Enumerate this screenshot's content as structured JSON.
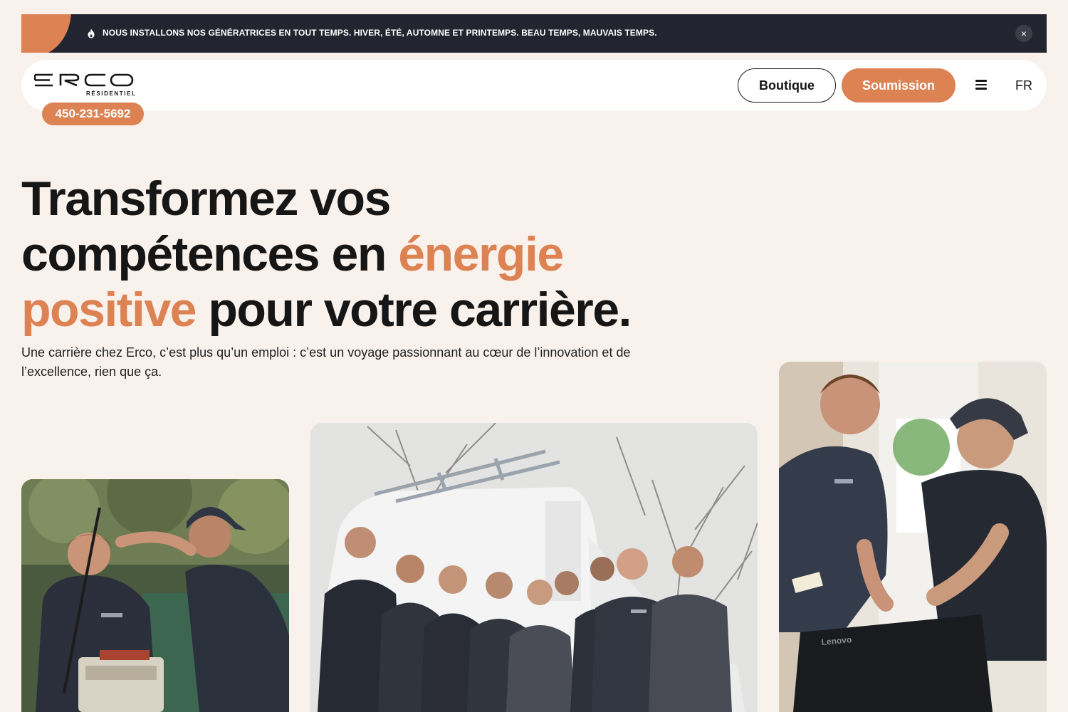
{
  "announcement": {
    "text": "NOUS INSTALLONS NOS GÉNÉRATRICES EN TOUT TEMPS. HIVER, ÉTÉ, AUTOMNE ET PRINTEMPS. BEAU TEMPS, MAUVAIS TEMPS.",
    "close_label": "×",
    "icon": "flame-icon"
  },
  "header": {
    "logo_text": "ERCO",
    "logo_sub": "RÉSIDENTIEL",
    "boutique_label": "Boutique",
    "soumission_label": "Soumission",
    "menu_icon": "hamburger-menu-icon",
    "lang_label": "FR",
    "phone": "450-231-5692"
  },
  "hero": {
    "line1": "Transformez vos",
    "line2_start": "compétences en ",
    "line2_accent": "énergie",
    "line3_accent": "positive",
    "line3_end": " pour votre carrière.",
    "lede": "Une carrière chez Erco, c’est plus qu’un emploi : c’est un voyage passionnant au cœur de l’innovation et de l’excellence, rien que ça."
  },
  "photos": {
    "left_label": "ERCO",
    "center_label": "ERCO",
    "right_label": "ERCO",
    "laptop_brand": "Lenovo"
  },
  "colors": {
    "accent": "#dc8253",
    "dark": "#22242f",
    "background": "#f9f1eb"
  }
}
